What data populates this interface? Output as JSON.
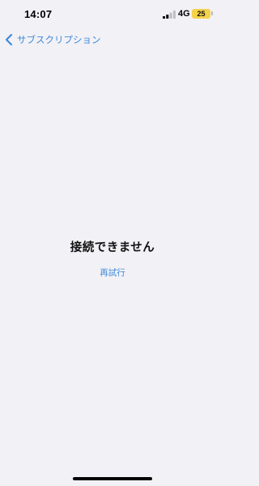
{
  "status_bar": {
    "time": "14:07",
    "network": "4G",
    "battery": "25"
  },
  "nav": {
    "back_label": "サブスクリプション"
  },
  "main": {
    "error_title": "接続できません",
    "retry_label": "再試行"
  },
  "colors": {
    "background": "#f2f1f6",
    "accent": "#3f8ad8",
    "battery": "#f4d24a"
  }
}
